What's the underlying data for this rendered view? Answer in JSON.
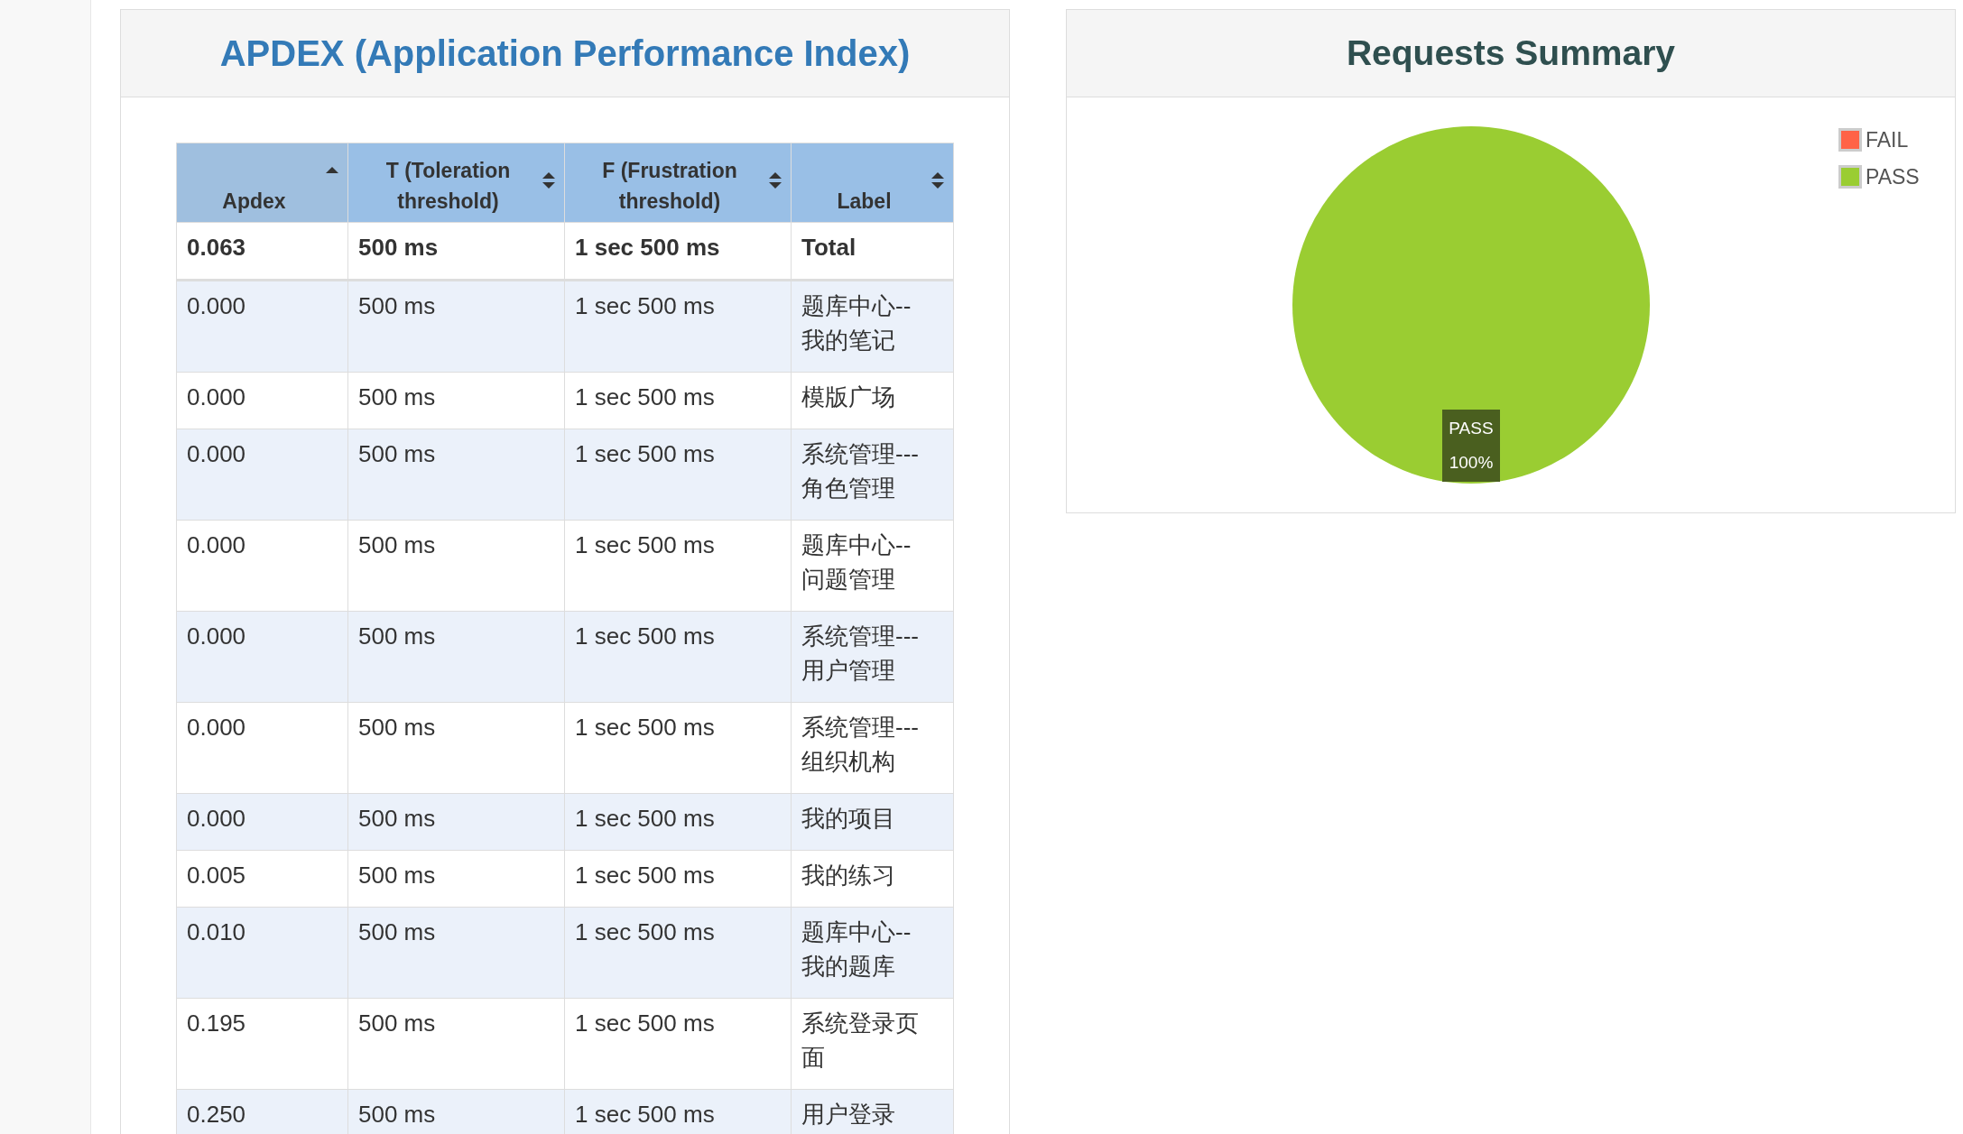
{
  "apdex_panel": {
    "title": "APDEX (Application Performance Index)",
    "table": {
      "columns": [
        {
          "label": "Apdex",
          "selected": true
        },
        {
          "label": "T (Toleration threshold)",
          "selected": false
        },
        {
          "label": "F (Frustration threshold)",
          "selected": false
        },
        {
          "label": "Label",
          "selected": false
        }
      ],
      "total": {
        "apdex": "0.063",
        "t": "500 ms",
        "f": "1 sec 500 ms",
        "label": "Total"
      },
      "rows": [
        {
          "apdex": "0.000",
          "t": "500 ms",
          "f": "1 sec 500 ms",
          "label": "题库中心--我的笔记"
        },
        {
          "apdex": "0.000",
          "t": "500 ms",
          "f": "1 sec 500 ms",
          "label": "模版广场"
        },
        {
          "apdex": "0.000",
          "t": "500 ms",
          "f": "1 sec 500 ms",
          "label": "系统管理---角色管理"
        },
        {
          "apdex": "0.000",
          "t": "500 ms",
          "f": "1 sec 500 ms",
          "label": "题库中心--问题管理"
        },
        {
          "apdex": "0.000",
          "t": "500 ms",
          "f": "1 sec 500 ms",
          "label": "系统管理---用户管理"
        },
        {
          "apdex": "0.000",
          "t": "500 ms",
          "f": "1 sec 500 ms",
          "label": "系统管理---组织机构"
        },
        {
          "apdex": "0.000",
          "t": "500 ms",
          "f": "1 sec 500 ms",
          "label": "我的项目"
        },
        {
          "apdex": "0.005",
          "t": "500 ms",
          "f": "1 sec 500 ms",
          "label": "我的练习"
        },
        {
          "apdex": "0.010",
          "t": "500 ms",
          "f": "1 sec 500 ms",
          "label": "题库中心--我的题库"
        },
        {
          "apdex": "0.195",
          "t": "500 ms",
          "f": "1 sec 500 ms",
          "label": "系统登录页面"
        },
        {
          "apdex": "0.250",
          "t": "500 ms",
          "f": "1 sec 500 ms",
          "label": "用户登录"
        }
      ]
    }
  },
  "summary_panel": {
    "title": "Requests Summary",
    "chart_data": {
      "type": "pie",
      "categories": [
        "FAIL",
        "PASS"
      ],
      "series": [
        {
          "values": [
            0,
            100
          ]
        }
      ],
      "colors": [
        "#ff6347",
        "#9acd32"
      ],
      "value_labels": [
        {
          "text": "PASS",
          "percent": "100%"
        }
      ]
    }
  }
}
